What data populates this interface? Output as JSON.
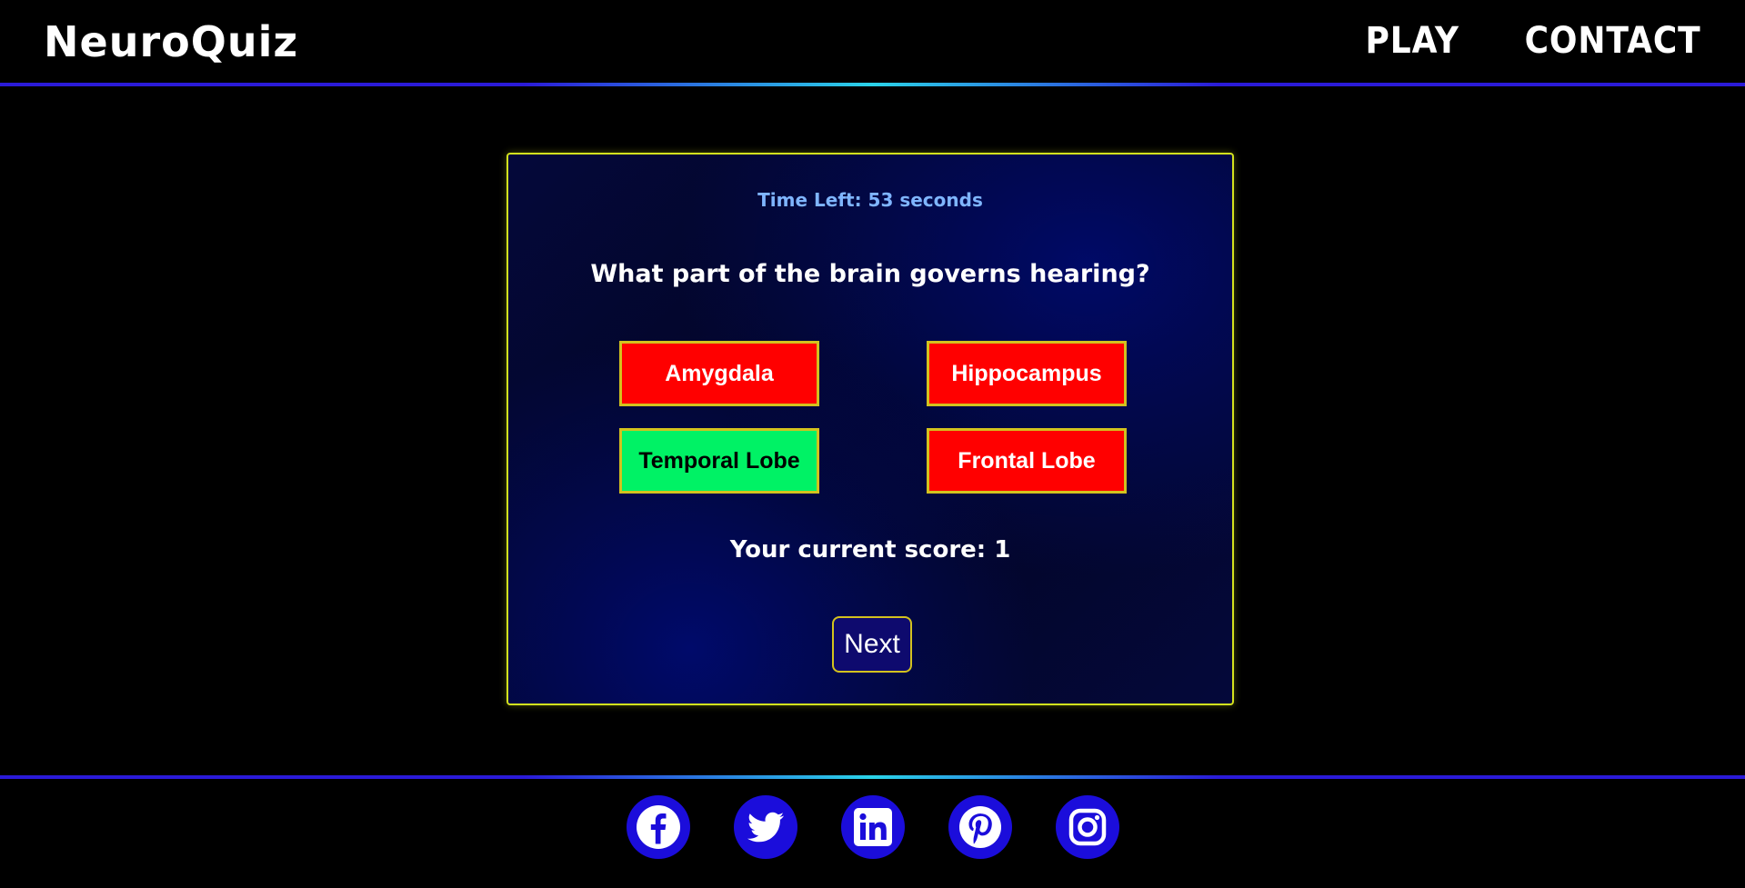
{
  "header": {
    "logo": "NeuroQuiz",
    "nav": [
      {
        "label": "PLAY"
      },
      {
        "label": "CONTACT"
      }
    ]
  },
  "quiz": {
    "timer_text": "Time Left: 53 seconds",
    "question": "What part of the brain governs hearing?",
    "answers": [
      {
        "label": "Amygdala",
        "state": "wrong"
      },
      {
        "label": "Hippocampus",
        "state": "wrong"
      },
      {
        "label": "Temporal Lobe",
        "state": "correct"
      },
      {
        "label": "Frontal Lobe",
        "state": "wrong"
      }
    ],
    "score_text": "Your current score: 1",
    "next_label": "Next"
  },
  "footer": {
    "socials": [
      {
        "icon": "facebook-icon"
      },
      {
        "icon": "twitter-icon"
      },
      {
        "icon": "linkedin-icon"
      },
      {
        "icon": "pinterest-icon"
      },
      {
        "icon": "instagram-icon"
      }
    ]
  },
  "colors": {
    "accent_border": "#d3e21e",
    "wrong": "#ff0000",
    "correct": "#00f265",
    "social_bg": "#1b0ddb",
    "timer": "#7fb5ff"
  }
}
